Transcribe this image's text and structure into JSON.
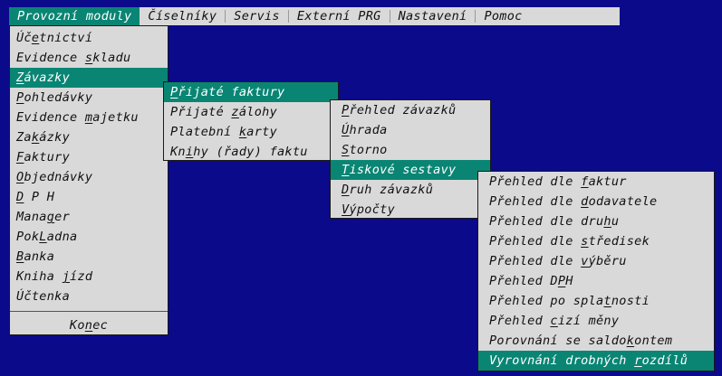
{
  "menubar": {
    "items": [
      {
        "label": "Provozní moduly",
        "active": true
      },
      {
        "label": "Číselníky"
      },
      {
        "label": "Servis"
      },
      {
        "label": "Externí PRG"
      },
      {
        "label": "Nastavení"
      },
      {
        "label": "Pomoc"
      }
    ]
  },
  "main_menu": {
    "items": [
      {
        "pre": "Úč",
        "key": "e",
        "post": "tnictví"
      },
      {
        "pre": "Evidence ",
        "key": "s",
        "post": "kladu"
      },
      {
        "pre": "",
        "key": "Z",
        "post": "ávazky"
      },
      {
        "pre": "",
        "key": "P",
        "post": "ohledávky"
      },
      {
        "pre": "Evidence ",
        "key": "m",
        "post": "ajetku"
      },
      {
        "pre": "Za",
        "key": "k",
        "post": "ázky"
      },
      {
        "pre": "",
        "key": "F",
        "post": "aktury"
      },
      {
        "pre": "",
        "key": "O",
        "post": "bjednávky"
      },
      {
        "pre": "",
        "key": "D",
        "post": " P H"
      },
      {
        "pre": "Mana",
        "key": "g",
        "post": "er"
      },
      {
        "pre": "Pok",
        "key": "L",
        "post": "adna"
      },
      {
        "pre": "",
        "key": "B",
        "post": "anka"
      },
      {
        "pre": "Kniha ",
        "key": "j",
        "post": "ízd"
      },
      {
        "pre": "Účtenka",
        "key": "",
        "post": ""
      }
    ],
    "exit": {
      "pre": "Ko",
      "key": "n",
      "post": "ec"
    }
  },
  "zavazky_menu": {
    "items": [
      {
        "pre": "",
        "key": "P",
        "post": "řijaté faktury"
      },
      {
        "pre": "Přijaté ",
        "key": "z",
        "post": "álohy"
      },
      {
        "pre": "Platební ",
        "key": "k",
        "post": "arty"
      },
      {
        "pre": "Kn",
        "key": "i",
        "post": "hy (řady) faktu"
      }
    ]
  },
  "faktury_menu": {
    "items": [
      {
        "pre": "",
        "key": "P",
        "post": "řehled  závazků"
      },
      {
        "pre": "",
        "key": "Ú",
        "post": "hrada"
      },
      {
        "pre": "",
        "key": "S",
        "post": "torno"
      },
      {
        "pre": "",
        "key": "T",
        "post": "iskové sestavy"
      },
      {
        "pre": "",
        "key": "D",
        "post": "ruh závazků"
      },
      {
        "pre": "",
        "key": "V",
        "post": "ýpočty"
      }
    ]
  },
  "sestavy_menu": {
    "items": [
      {
        "pre": "Přehled dle ",
        "key": "f",
        "post": "aktur"
      },
      {
        "pre": "Přehled dle ",
        "key": "d",
        "post": "odavatele"
      },
      {
        "pre": "Přehled dle dru",
        "key": "h",
        "post": "u"
      },
      {
        "pre": "Přehled dle ",
        "key": "s",
        "post": "tředisek"
      },
      {
        "pre": "Přehled dle ",
        "key": "v",
        "post": "ýběru"
      },
      {
        "pre": "Přehled D",
        "key": "P",
        "post": "H"
      },
      {
        "pre": "Přehled po spla",
        "key": "t",
        "post": "nosti"
      },
      {
        "pre": "Přehled ",
        "key": "c",
        "post": "izí měny"
      },
      {
        "pre": "Porovnání se saldo",
        "key": "k",
        "post": "ontem"
      },
      {
        "pre": "Vyrovnání drobných ",
        "key": "r",
        "post": "ozdílů"
      }
    ]
  },
  "colors": {
    "background": "#0a0a8a",
    "menu": "#d9d9d9",
    "highlight": "#0a8574"
  }
}
